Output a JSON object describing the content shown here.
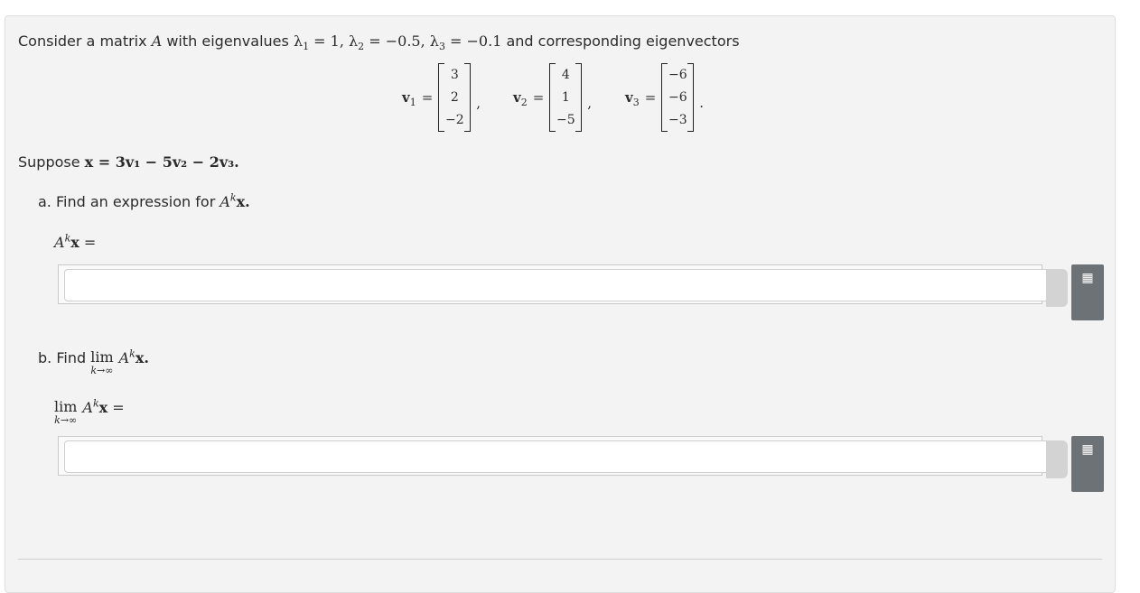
{
  "intro": {
    "lead": "Consider a matrix",
    "matrix": "A",
    "with_eig": "with eigenvalues",
    "lam1": "λ",
    "lam1_sub": "1",
    "lam1_val": "= 1,",
    "lam2": "λ",
    "lam2_sub": "2",
    "lam2_val": "= −0.5,",
    "lam3": "λ",
    "lam3_sub": "3",
    "lam3_val": "= −0.1",
    "tail": "and corresponding eigenvectors"
  },
  "vectors": [
    {
      "label": "v",
      "sub": "1",
      "eq": "=",
      "entries": [
        "3",
        "2",
        "−2"
      ],
      "sep": ","
    },
    {
      "label": "v",
      "sub": "2",
      "eq": "=",
      "entries": [
        "4",
        "1",
        "−5"
      ],
      "sep": ","
    },
    {
      "label": "v",
      "sub": "3",
      "eq": "=",
      "entries": [
        "−6",
        "−6",
        "−3"
      ],
      "sep": "."
    }
  ],
  "suppose": {
    "lead": "Suppose",
    "expr": "x = 3v₁ − 5v₂ − 2v₃."
  },
  "part_a": {
    "label": "a. Find an expression for",
    "expr_A": "A",
    "expr_k": "k",
    "expr_x": "x.",
    "answer_label_A": "A",
    "answer_label_k": "k",
    "answer_label_x": "x",
    "answer_label_eq": "=",
    "value": "",
    "placeholder": ""
  },
  "part_b": {
    "label": "b. Find",
    "lim": "lim",
    "lim_sub": "k→∞",
    "expr_A": "A",
    "expr_k": "k",
    "expr_x": "x.",
    "answer_lim": "lim",
    "answer_lim_sub": "k→∞",
    "answer_A": "A",
    "answer_k": "k",
    "answer_x": "x",
    "answer_eq": "=",
    "value": "",
    "placeholder": ""
  },
  "icons": {
    "keyboard": "keyboard-icon"
  },
  "colors": {
    "panel": "#f3f3f3",
    "keypad_button": "#6d7277"
  }
}
